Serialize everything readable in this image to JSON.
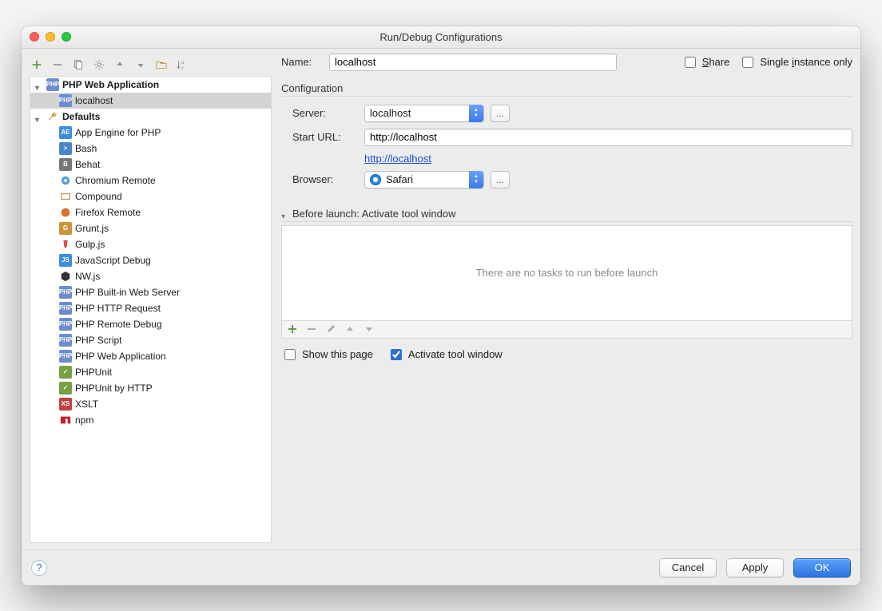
{
  "window": {
    "title": "Run/Debug Configurations"
  },
  "toolbar_icons": [
    "add",
    "remove",
    "copy",
    "settings",
    "up",
    "down",
    "folder",
    "sort-az"
  ],
  "tree": {
    "groups": [
      {
        "label": "PHP Web Application",
        "icon": "php-web",
        "expanded": true,
        "bold": true,
        "children": [
          {
            "label": "localhost",
            "icon": "php-web",
            "selected": true
          }
        ]
      },
      {
        "label": "Defaults",
        "icon": "wrench",
        "expanded": true,
        "bold": true,
        "children": [
          {
            "label": "App Engine for PHP",
            "icon": "appengine"
          },
          {
            "label": "Bash",
            "icon": "bash"
          },
          {
            "label": "Behat",
            "icon": "behat"
          },
          {
            "label": "Chromium Remote",
            "icon": "chromium"
          },
          {
            "label": "Compound",
            "icon": "compound"
          },
          {
            "label": "Firefox Remote",
            "icon": "firefox"
          },
          {
            "label": "Grunt.js",
            "icon": "grunt"
          },
          {
            "label": "Gulp.js",
            "icon": "gulp"
          },
          {
            "label": "JavaScript Debug",
            "icon": "jsdebug"
          },
          {
            "label": "NW.js",
            "icon": "nw"
          },
          {
            "label": "PHP Built-in Web Server",
            "icon": "php"
          },
          {
            "label": "PHP HTTP Request",
            "icon": "php"
          },
          {
            "label": "PHP Remote Debug",
            "icon": "php"
          },
          {
            "label": "PHP Script",
            "icon": "php"
          },
          {
            "label": "PHP Web Application",
            "icon": "php-web"
          },
          {
            "label": "PHPUnit",
            "icon": "phpunit"
          },
          {
            "label": "PHPUnit by HTTP",
            "icon": "phpunit"
          },
          {
            "label": "XSLT",
            "icon": "xslt"
          },
          {
            "label": "npm",
            "icon": "npm"
          }
        ]
      }
    ]
  },
  "form": {
    "name_label": "Name:",
    "name_value": "localhost",
    "share_label": "Share",
    "share_checked": false,
    "single_instance_label": "Single instance only",
    "single_instance_checked": false,
    "configuration_title": "Configuration",
    "server_label": "Server:",
    "server_value": "localhost",
    "server_more": "...",
    "starturl_label": "Start URL:",
    "starturl_value": "http://localhost",
    "starturl_link": "http://localhost",
    "browser_label": "Browser:",
    "browser_value": "Safari",
    "browser_more": "...",
    "before_launch_title": "Before launch: Activate tool window",
    "empty_tasks_text": "There are no tasks to run before launch",
    "show_this_page_label": "Show this page",
    "show_this_page_checked": false,
    "activate_tool_window_label": "Activate tool window",
    "activate_tool_window_checked": true
  },
  "footer": {
    "cancel": "Cancel",
    "apply": "Apply",
    "ok": "OK"
  }
}
